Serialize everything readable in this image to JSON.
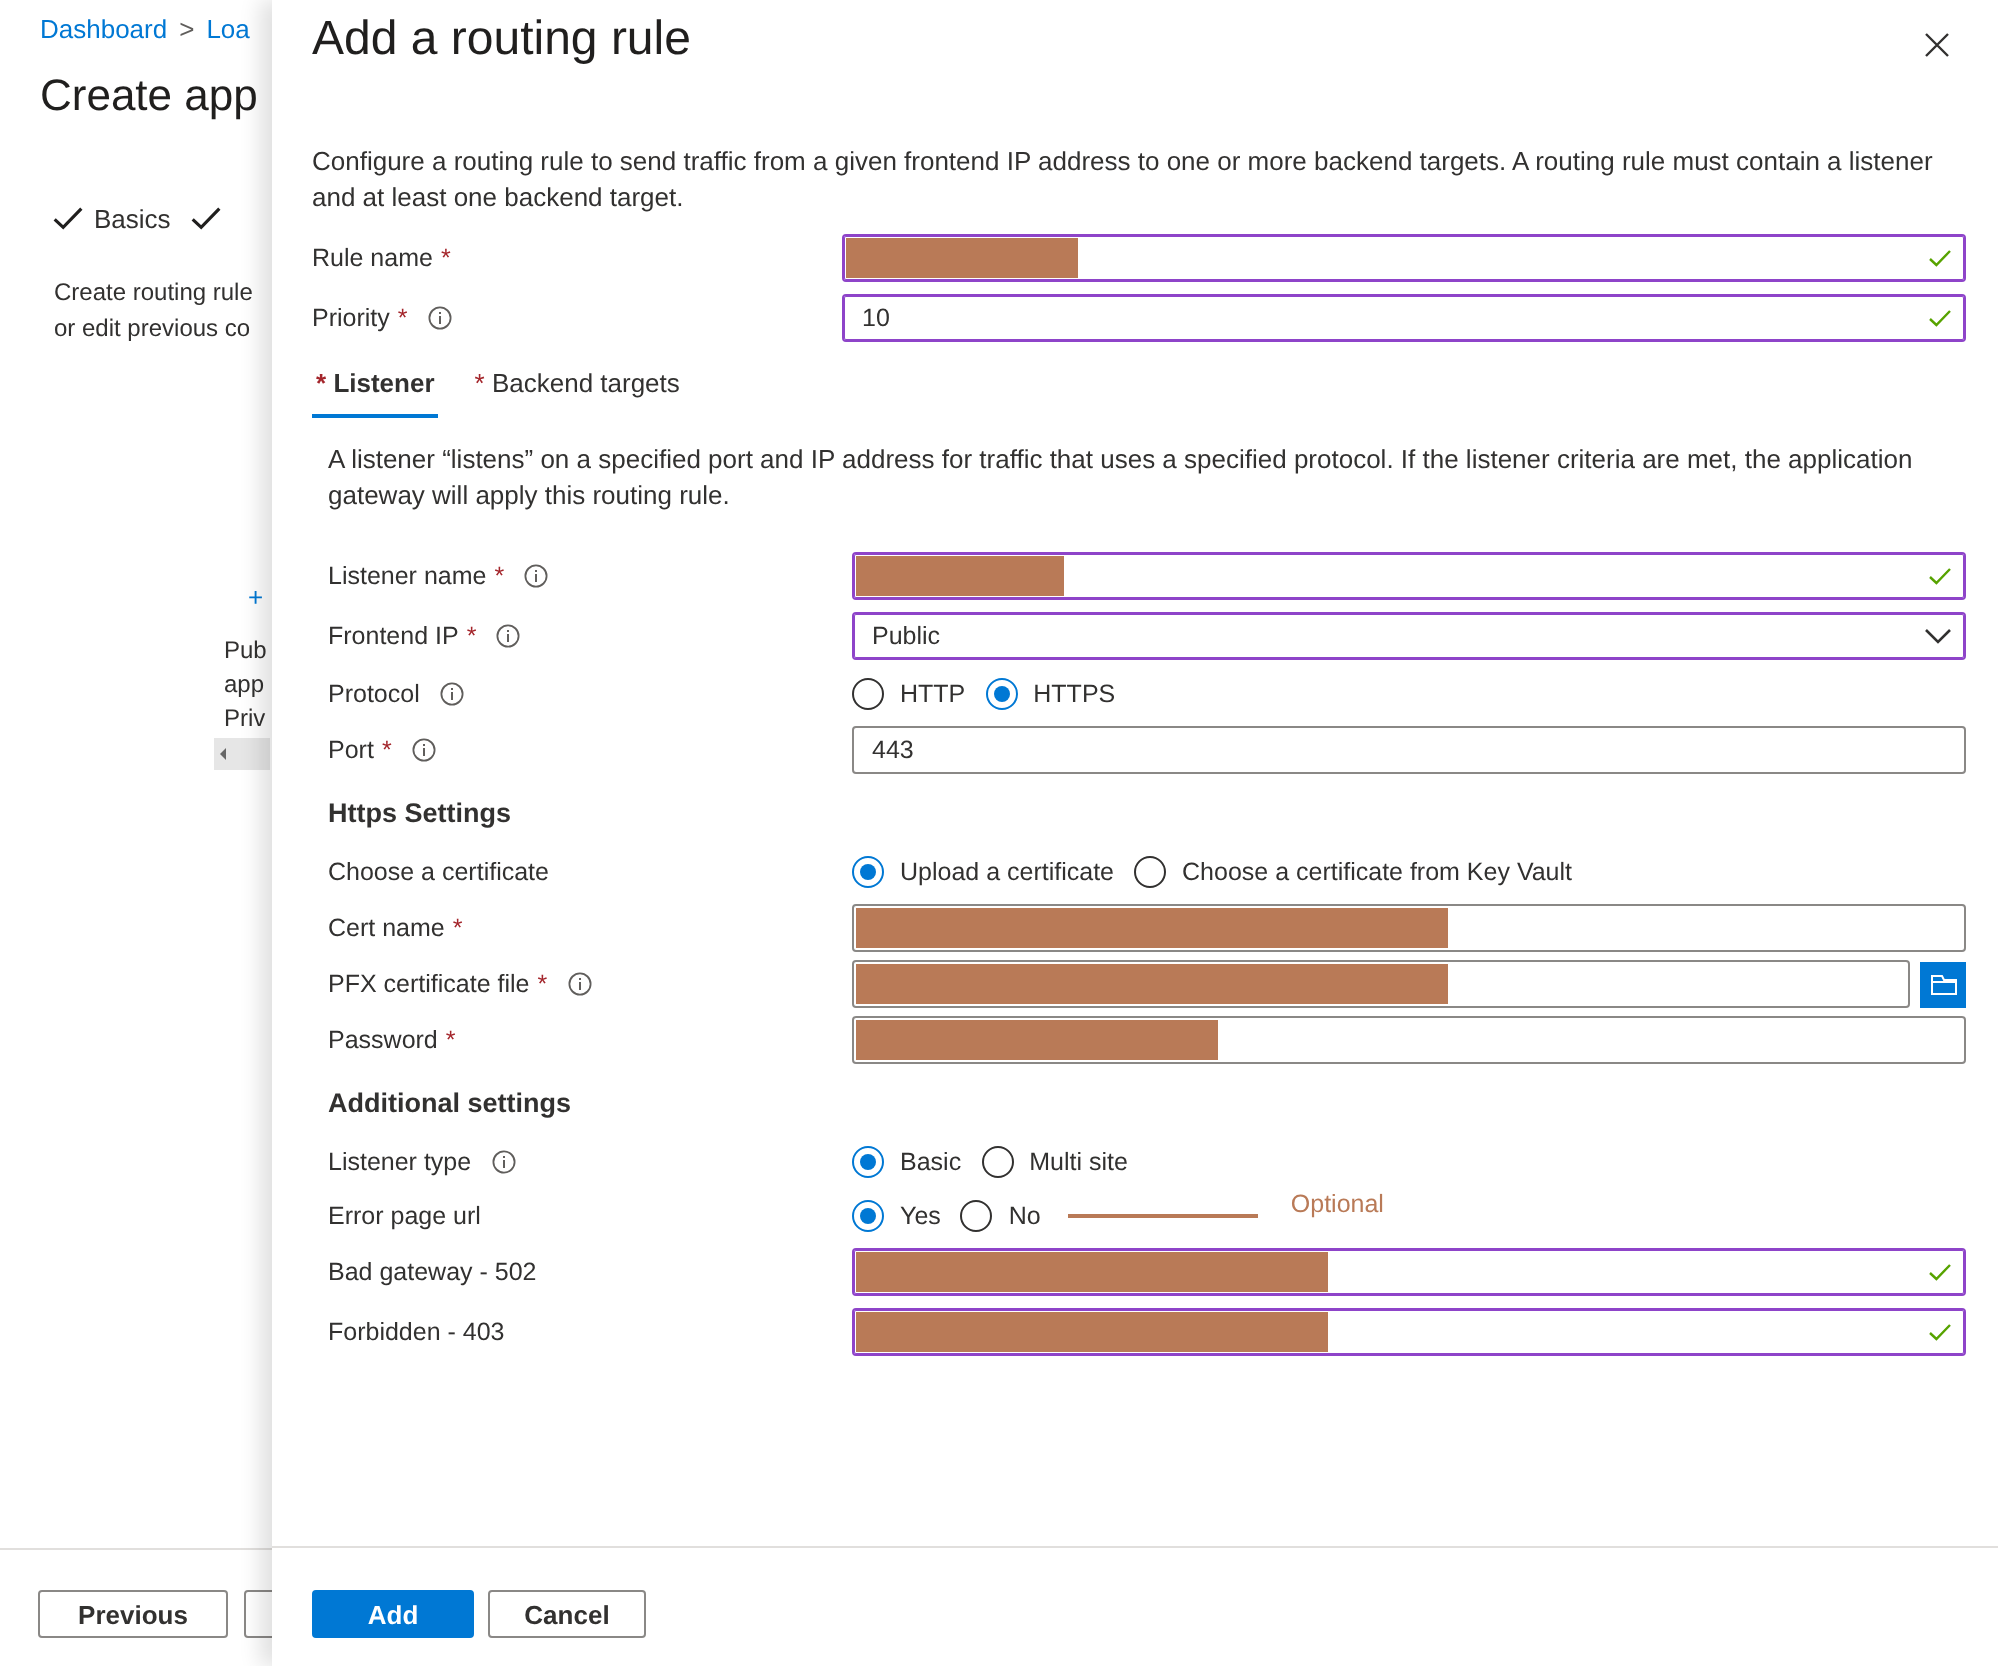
{
  "background_page": {
    "breadcrumb": [
      "Dashboard",
      ">",
      "Loa"
    ],
    "title": "Create app",
    "steps": [
      {
        "label": "Basics",
        "done": true
      },
      {
        "done": true
      }
    ],
    "description": [
      "Create routing rule",
      "or edit previous co"
    ],
    "add_link": "+",
    "list_items": [
      "Pub",
      "app",
      "Priv"
    ],
    "buttons": [
      "Previous"
    ]
  },
  "panel": {
    "title": "Add a routing rule",
    "description": "Configure a routing rule to send traffic from a given frontend IP address to one or more backend targets. A routing rule must contain a listener and at least one backend target.",
    "top_rows": [
      {
        "kind": "text",
        "label": "Rule name",
        "mark": "*",
        "info": false,
        "valid": true,
        "level": 0.21
      },
      {
        "kind": "text",
        "label": "Priority",
        "mark": "*",
        "info": true,
        "valid": true,
        "value": "10"
      }
    ],
    "tabs": [
      {
        "mark": "*",
        "label": "Listener",
        "selected": true
      },
      {
        "mark": "*",
        "label": "Backend targets",
        "selected": false
      }
    ],
    "listener": {
      "description": "A listener “listens” on a specified port and IP address for traffic that uses a specified protocol. If the listener criteria are met, the application gateway will apply this routing rule.",
      "rows": [
        {
          "kind": "text",
          "label": "Listener name",
          "mark": "*",
          "info": true,
          "valid": true,
          "level": 0.19
        },
        {
          "kind": "dropdown",
          "label": "Frontend IP",
          "mark": "*",
          "info": true,
          "valid": true,
          "value": "Public"
        },
        {
          "kind": "radio",
          "label": "Protocol",
          "info": true,
          "options": [
            {
              "label": "HTTP",
              "selected": false
            },
            {
              "label": "HTTPS",
              "selected": true
            }
          ]
        },
        {
          "kind": "text",
          "label": "Port",
          "mark": "*",
          "info": true,
          "valid": false,
          "value": "443"
        },
        {
          "kind": "heading",
          "label": "Https Settings"
        },
        {
          "kind": "radio",
          "label": "Choose a certificate",
          "info": false,
          "options": [
            {
              "label": "Upload a certificate",
              "selected": true
            },
            {
              "label": "Choose a certificate from Key Vault",
              "selected": false
            }
          ]
        },
        {
          "kind": "text",
          "label": "Cert name",
          "mark": "*",
          "info": false,
          "valid": false,
          "level": 0.54
        },
        {
          "kind": "file",
          "label": "PFX certificate file",
          "mark": "*",
          "info": true,
          "valid": false,
          "level": 0.57
        },
        {
          "kind": "text",
          "label": "Password",
          "mark": "*",
          "info": false,
          "valid": false,
          "level": 0.33
        },
        {
          "kind": "heading",
          "label": "Additional settings"
        },
        {
          "kind": "radio",
          "label": "Listener type",
          "info": true,
          "options": [
            {
              "label": "Basic",
              "selected": true
            },
            {
              "label": "Multi site",
              "selected": false
            }
          ]
        },
        {
          "kind": "radio",
          "label": "Error page url",
          "info": false,
          "annotation": "Optional",
          "options": [
            {
              "label": "Yes",
              "selected": true
            },
            {
              "label": "No",
              "selected": false
            }
          ]
        },
        {
          "kind": "text",
          "label": "Bad gateway - 502",
          "info": false,
          "valid": true,
          "level": 0.43
        },
        {
          "kind": "text",
          "label": "Forbidden - 403",
          "info": false,
          "valid": true,
          "level": 0.43
        }
      ]
    },
    "buttons": [
      {
        "label": "Add",
        "primary": true
      },
      {
        "label": "Cancel",
        "primary": false
      }
    ]
  }
}
